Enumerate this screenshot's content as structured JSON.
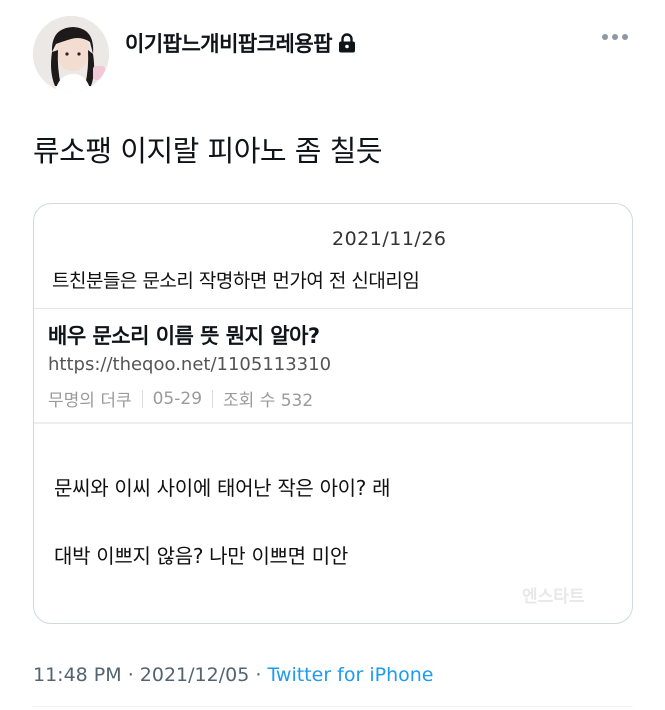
{
  "tweet": {
    "author": {
      "display_name": "이기팝느개비팝크레용팝",
      "protected_icon": "lock-icon",
      "avatar_icon": "profile-photo"
    },
    "more_icon": "more-horizontal-icon",
    "text": "류소팽 이지랄 피아노 좀 칠듯",
    "media": {
      "date": "2021/11/26",
      "note": "트친분들은 문소리 작명하면 먼가여 전 신대리임",
      "post": {
        "title": "배우 문소리 이름 뜻 뭔지 알아?",
        "url": "https://theqoo.net/1105113310",
        "author": "무명의 더쿠",
        "date": "05-29",
        "views": "조회 수 532"
      },
      "comment_lines": [
        "문씨와 이씨 사이에 태어난 작은 아이? 래",
        "대박 이쁘지 않음? 나만 이쁘면 미안"
      ],
      "watermark": "엔스타트"
    },
    "meta": {
      "time": "11:48 PM",
      "separator": "·",
      "date": "2021/12/05",
      "source": "Twitter for iPhone"
    }
  },
  "colors": {
    "text": "#0f1419",
    "secondary": "#536471",
    "link": "#1d9bf0",
    "border": "#cfd9de"
  }
}
